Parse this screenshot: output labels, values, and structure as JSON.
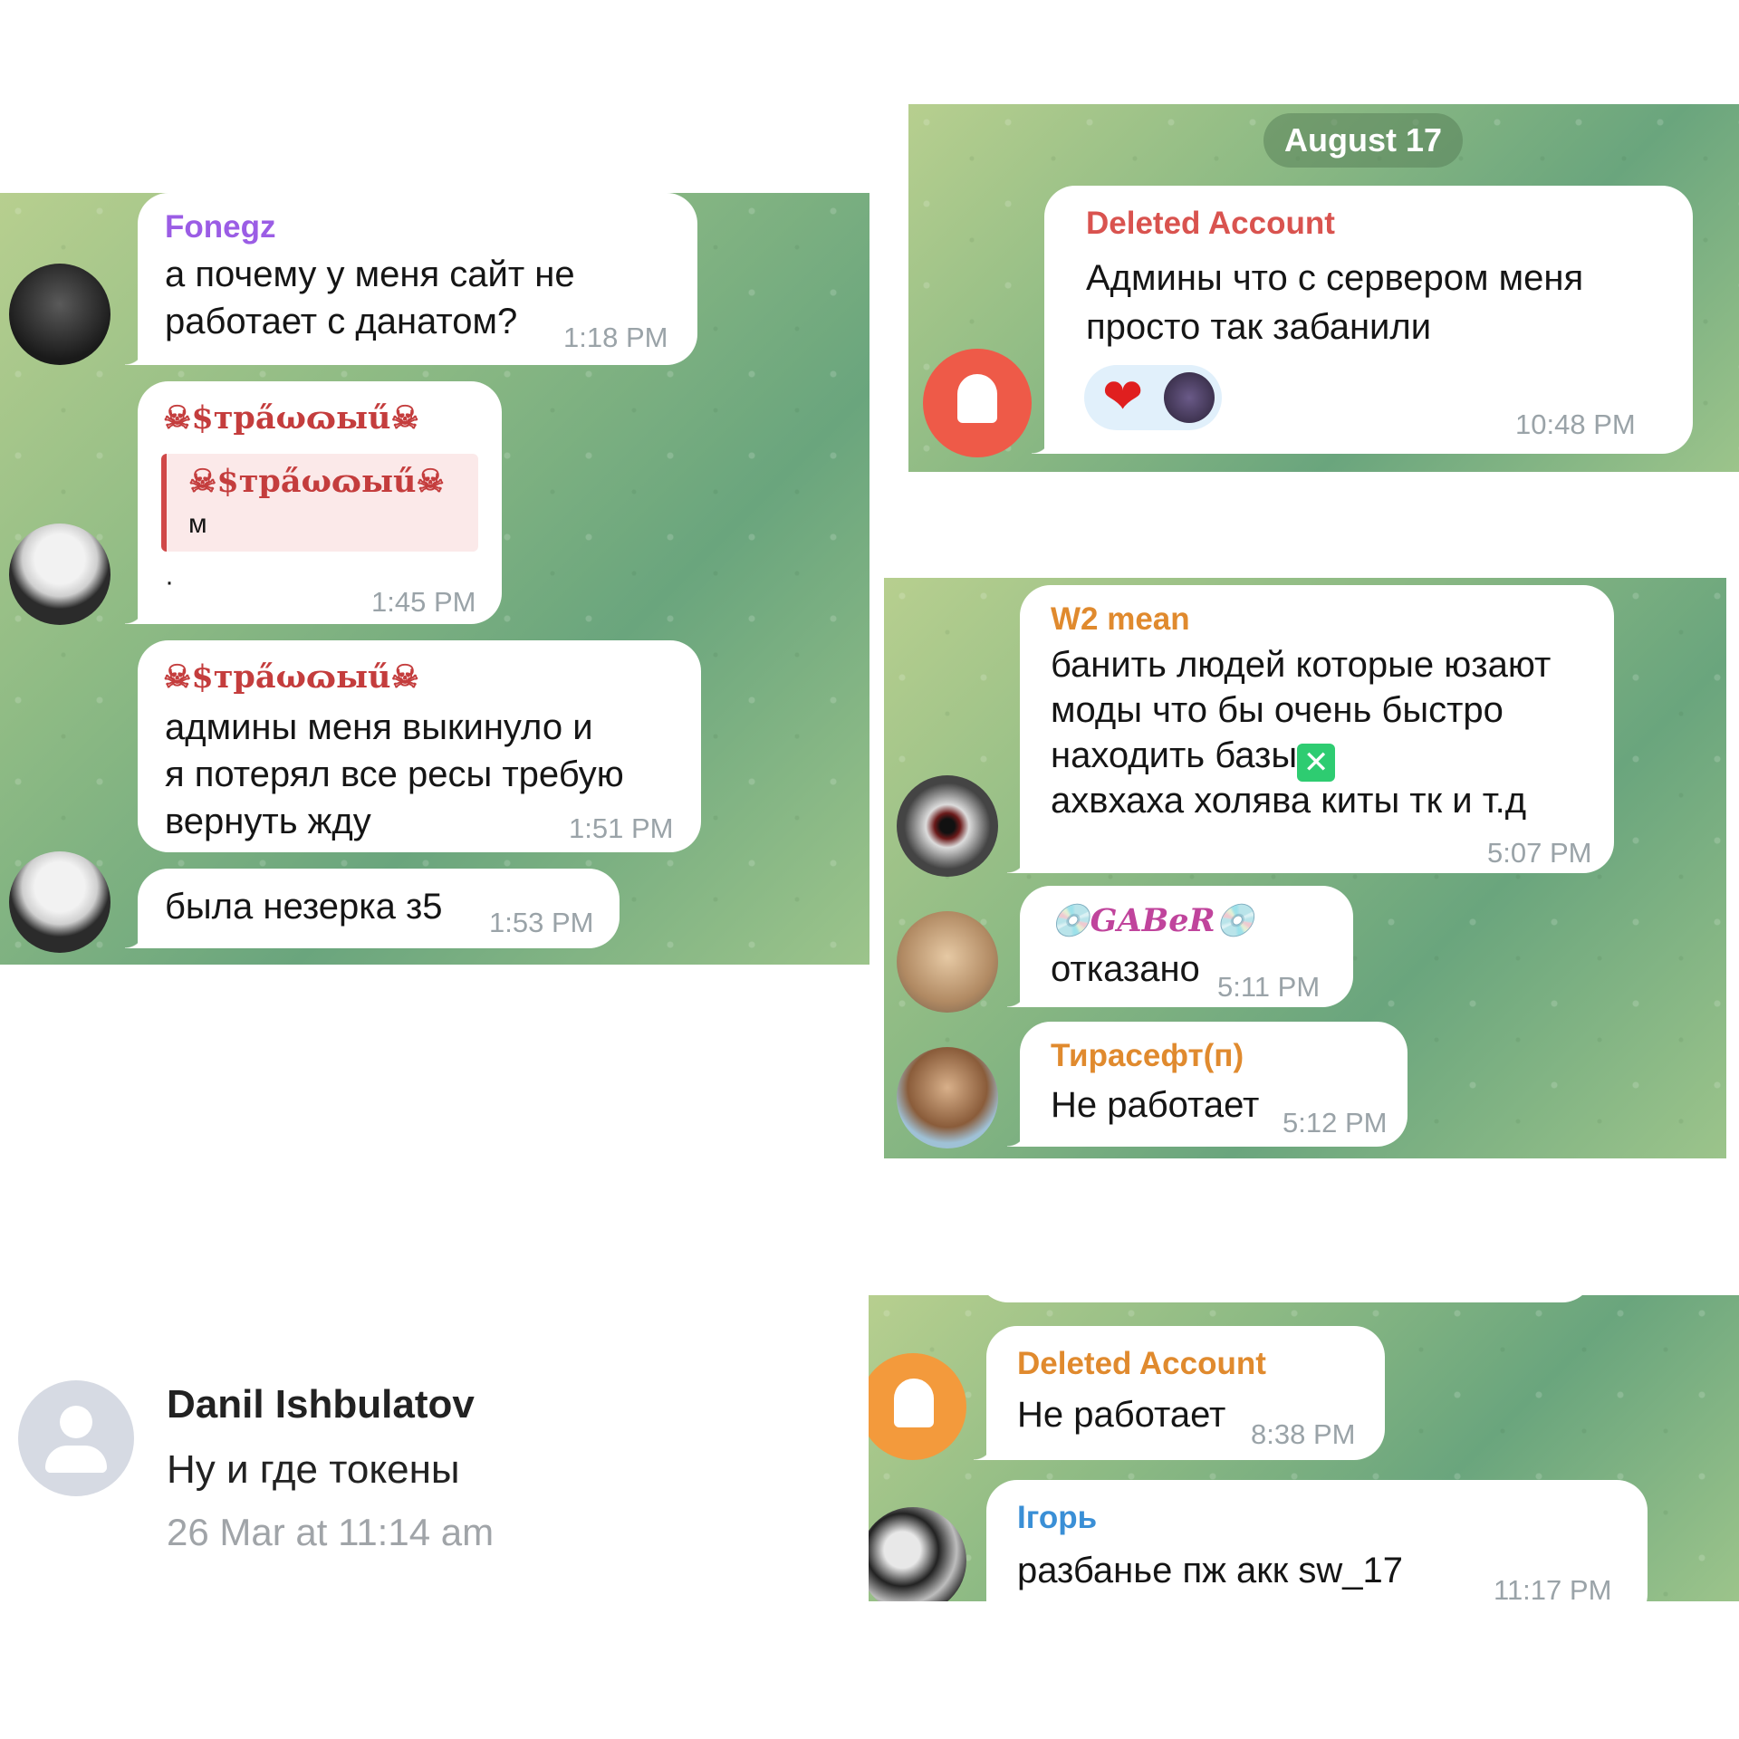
{
  "panel1": {
    "messages": [
      {
        "sender": "Fonegz",
        "text1": "а почему у меня сайт не",
        "text2": "работает с данатом?",
        "time": "1:18 PM",
        "avatar_icon": "dark-figure-avatar"
      },
      {
        "sender": "☠$тpa̋ωɷыű☠",
        "quote_sender": "☠$тpa̋ωɷыű☠",
        "quote_text": "м",
        "text1": "·",
        "time": "1:45 PM",
        "avatar_icon": "white-hair-avatar"
      },
      {
        "sender": "☠$тpa̋ωɷыű☠",
        "text1": "админы меня выкинуло и",
        "text2": "я потерял все ресы требую",
        "text3": "вернуть жду",
        "time": "1:51 PM"
      },
      {
        "text1": "была незерка з5",
        "time": "1:53 PM",
        "avatar_icon": "white-hair-avatar"
      }
    ]
  },
  "panel2": {
    "date": "August 17",
    "message": {
      "sender": "Deleted Account",
      "text1": "Админы что с сервером меня",
      "text2": "просто так забанили",
      "time": "10:48 PM",
      "reaction": "❤",
      "avatar_icon": "ghost-avatar"
    }
  },
  "panel3": {
    "messages": [
      {
        "sender": "W2 mean",
        "text1": "банить людей которые юзают",
        "text2": "моды что бы очень быстро",
        "text3": "находить базы",
        "text4": "ахвхаха холява киты тк и т.д",
        "time": "5:07 PM",
        "avatar_icon": "eye-avatar"
      },
      {
        "sender": "GABeR",
        "text1": "отказано",
        "time": "5:11 PM",
        "avatar_icon": "cat-avatar"
      },
      {
        "sender": "Тирасефт(п)",
        "text1": "Не работает",
        "time": "5:12 PM",
        "avatar_icon": "anime-avatar"
      }
    ]
  },
  "panel4": {
    "name": "Danil Ishbulatov",
    "message": "Ну и где токены",
    "date": "26 Mar at 11:14 am",
    "avatar_icon": "user-placeholder-icon"
  },
  "panel5": {
    "messages": [
      {
        "sender": "Deleted Account",
        "text1": "Не работает",
        "time": "8:38 PM",
        "avatar_icon": "ghost-avatar"
      },
      {
        "sender": "Ігорь",
        "text1": "разбанье пж акк sw_17",
        "time": "11:17 PM",
        "avatar_icon": "bw-sketch-avatar"
      }
    ]
  },
  "colors": {
    "fonegz": "#9b5de5",
    "fancy": "#c43d3d",
    "deleted": "#d9534f",
    "w2": "#e08a2e",
    "gaber": "#c0449c",
    "tiraseft": "#e08a2e",
    "deleted_orange": "#e08a2e",
    "igor": "#3a8fd6"
  }
}
